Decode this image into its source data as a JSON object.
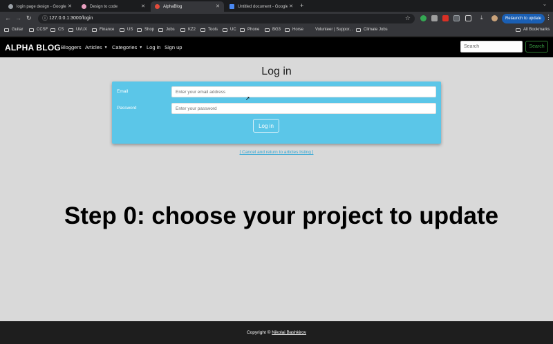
{
  "browser": {
    "tabs": [
      {
        "title": "login page design - Google S",
        "favicon_color": "#9aa0a6",
        "active": false
      },
      {
        "title": "Design to code",
        "favicon_color": "#e9a0c0",
        "active": false
      },
      {
        "title": "AlphaBlog",
        "favicon_color": "#e24b3b",
        "active": true
      },
      {
        "title": "Untitled document - Google D",
        "favicon_color": "#4a88f0",
        "active": false
      }
    ],
    "new_tab_icon": "plus-icon",
    "url": "127.0.0.1:3000/login",
    "relaunch_label": "Relaunch to update",
    "bookmarks": [
      "Guitar",
      "CCSF",
      "CS",
      "UI/UX",
      "Finance",
      "US",
      "Shop",
      "Jobs",
      "KZ2",
      "Tools",
      "UC",
      "Phone",
      "BG3",
      "Horse",
      "Volunteer | Suppor...",
      "Climate Jobs"
    ],
    "all_bookmarks_label": "All Bookmarks"
  },
  "site": {
    "brand": "ALPHA BLOG",
    "nav": {
      "bloggers": "Bloggers",
      "articles": "Articles",
      "categories": "Categories",
      "login": "Log in",
      "signup": "Sign up"
    },
    "search_placeholder": "Search",
    "search_button": "Search"
  },
  "login": {
    "title": "Log in",
    "email_label": "Email",
    "email_placeholder": "Enter your email address",
    "email_value": "",
    "password_label": "Password",
    "password_placeholder": "Enter your password",
    "password_value": "",
    "submit_label": "Log in",
    "cancel_link": "[ Cancel and return to articles listing ]"
  },
  "overlay_caption": "Step 0: choose your project to update",
  "footer": {
    "copyright_prefix": "Copyright ©",
    "author": "Nikolai Bashkirov"
  },
  "colors": {
    "card": "#5bc6e8",
    "navbar": "#000000",
    "page_bg": "#d9d9d9",
    "footer": "#1e1e1e",
    "search_button": "#3aa345",
    "link": "#2ea7d6"
  }
}
